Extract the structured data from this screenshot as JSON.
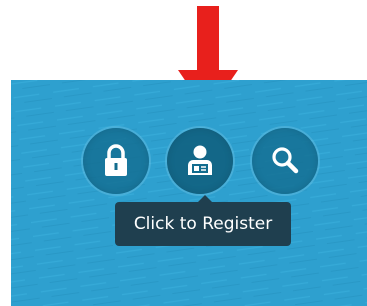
{
  "toolbar": {
    "buttons": [
      {
        "icon": "lock-icon"
      },
      {
        "icon": "user-id-icon"
      },
      {
        "icon": "search-icon"
      }
    ],
    "tooltip_text": "Click to Register"
  },
  "annotation": {
    "arrow_color": "#e8201c"
  },
  "colors": {
    "panel_background": "#2ea0cf",
    "button_fill": "#126c8e",
    "tooltip_background": "#1f3f4f"
  }
}
